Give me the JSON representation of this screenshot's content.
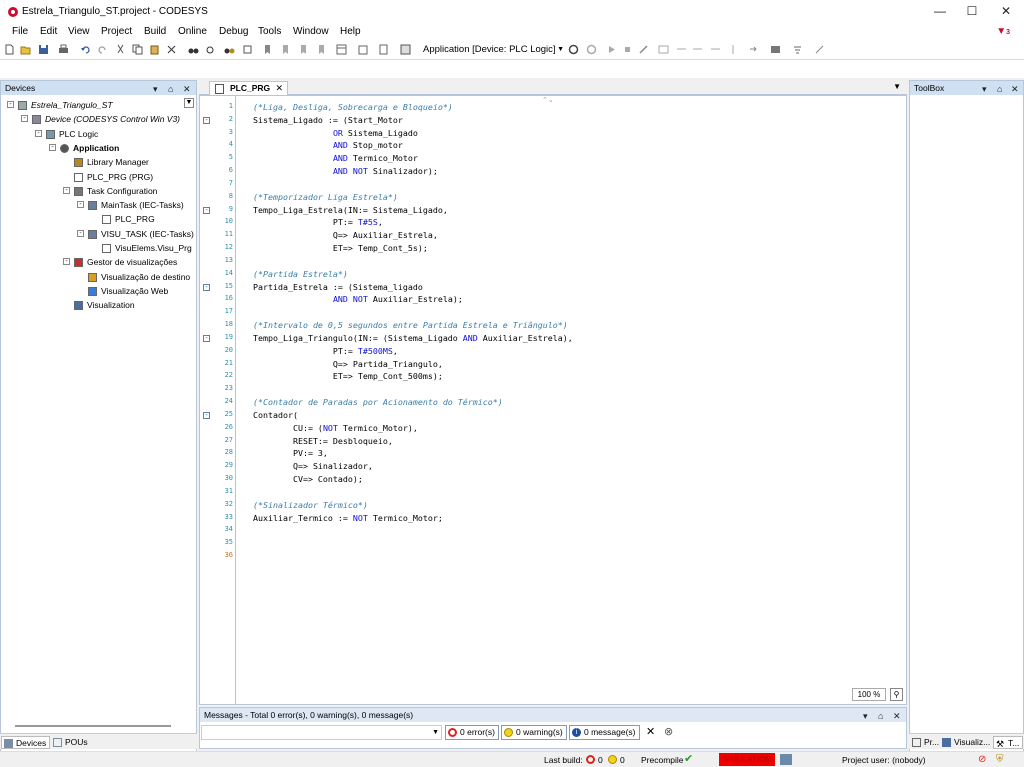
{
  "window": {
    "title": "Estrela_Triangulo_ST.project - CODESYS"
  },
  "menu": [
    "File",
    "Edit",
    "View",
    "Project",
    "Build",
    "Online",
    "Debug",
    "Tools",
    "Window",
    "Help"
  ],
  "alerts_count": "3",
  "toolbar": {
    "active_application": "Application [Device: PLC Logic]"
  },
  "devices_pane": {
    "title": "Devices",
    "tree": [
      {
        "label": "Estrela_Triangulo_ST",
        "depth": 0,
        "italic": true,
        "expander": "-",
        "icon": "project-icon"
      },
      {
        "label": "Device (CODESYS Control Win V3)",
        "depth": 1,
        "italic": true,
        "expander": "-",
        "icon": "device-icon"
      },
      {
        "label": "PLC Logic",
        "depth": 2,
        "expander": "-",
        "icon": "plc-logic-icon"
      },
      {
        "label": "Application",
        "depth": 3,
        "bold": true,
        "expander": "-",
        "icon": "application-icon"
      },
      {
        "label": "Library Manager",
        "depth": 4,
        "icon": "library-icon"
      },
      {
        "label": "PLC_PRG (PRG)",
        "depth": 4,
        "icon": "program-icon"
      },
      {
        "label": "Task Configuration",
        "depth": 4,
        "expander": "-",
        "icon": "task-config-icon"
      },
      {
        "label": "MainTask (IEC-Tasks)",
        "depth": 5,
        "expander": "-",
        "icon": "task-icon"
      },
      {
        "label": "PLC_PRG",
        "depth": 6,
        "icon": "call-icon"
      },
      {
        "label": "VISU_TASK (IEC-Tasks)",
        "depth": 5,
        "expander": "-",
        "icon": "task-icon"
      },
      {
        "label": "VisuElems.Visu_Prg",
        "depth": 6,
        "icon": "call-icon"
      },
      {
        "label": "Gestor de visualizações",
        "depth": 4,
        "expander": "-",
        "icon": "visu-manager-icon"
      },
      {
        "label": "Visualização de destino",
        "depth": 5,
        "icon": "target-visu-icon"
      },
      {
        "label": "Visualização Web",
        "depth": 5,
        "icon": "web-visu-icon"
      },
      {
        "label": "Visualization",
        "depth": 4,
        "icon": "visualization-icon"
      }
    ],
    "tabs": [
      "Devices",
      "POUs"
    ]
  },
  "editor": {
    "tab_title": "PLC_PRG",
    "zoom": "100 %",
    "lines": [
      [
        [
          "c",
          "(*Liga, Desliga, Sobrecarga e Bloqueio*)"
        ]
      ],
      [
        [
          "t",
          "Sistema_Ligado := (Start_Motor"
        ]
      ],
      [
        [
          "t",
          "                "
        ],
        [
          "k",
          "OR"
        ],
        [
          "t",
          " Sistema_Ligado"
        ]
      ],
      [
        [
          "t",
          "                "
        ],
        [
          "k",
          "AND"
        ],
        [
          "t",
          " Stop_motor"
        ]
      ],
      [
        [
          "t",
          "                "
        ],
        [
          "k",
          "AND"
        ],
        [
          "t",
          " Termico_Motor"
        ]
      ],
      [
        [
          "t",
          "                "
        ],
        [
          "k",
          "AND NOT"
        ],
        [
          "t",
          " Sinalizador);"
        ]
      ],
      [],
      [
        [
          "c",
          "(*Temporizador Liga Estrela*)"
        ]
      ],
      [
        [
          "t",
          "Tempo_Liga_Estrela(IN:= Sistema_Ligado,"
        ]
      ],
      [
        [
          "t",
          "                PT:= "
        ],
        [
          "k",
          "T#5S"
        ],
        [
          "t",
          ","
        ]
      ],
      [
        [
          "t",
          "                Q=> Auxiliar_Estrela,"
        ]
      ],
      [
        [
          "t",
          "                ET=> Temp_Cont_5s);"
        ]
      ],
      [],
      [
        [
          "c",
          "(*Partida Estrela*)"
        ]
      ],
      [
        [
          "t",
          "Partida_Estrela := (Sistema_ligado"
        ]
      ],
      [
        [
          "t",
          "                "
        ],
        [
          "k",
          "AND NOT"
        ],
        [
          "t",
          " Auxiliar_Estrela);"
        ]
      ],
      [],
      [
        [
          "c",
          "(*Intervalo de 0,5 segundos entre Partida Estrela e Triângulo*)"
        ]
      ],
      [
        [
          "t",
          "Tempo_Liga_Triangulo(IN:= (Sistema_Ligado "
        ],
        [
          "k",
          "AND"
        ],
        [
          "t",
          " Auxiliar_Estrela),"
        ]
      ],
      [
        [
          "t",
          "                PT:= "
        ],
        [
          "k",
          "T#500MS"
        ],
        [
          "t",
          ","
        ]
      ],
      [
        [
          "t",
          "                Q=> Partida_Triangulo,"
        ]
      ],
      [
        [
          "t",
          "                ET=> Temp_Cont_500ms);"
        ]
      ],
      [],
      [
        [
          "c",
          "(*Contador de Paradas por Acionamento do Térmico*)"
        ]
      ],
      [
        [
          "t",
          "Contador("
        ]
      ],
      [
        [
          "t",
          "        CU:= ("
        ],
        [
          "k",
          "NOT"
        ],
        [
          "t",
          " Termico_Motor),"
        ]
      ],
      [
        [
          "t",
          "        RESET:= Desbloqueio,"
        ]
      ],
      [
        [
          "t",
          "        PV:= 3,"
        ]
      ],
      [
        [
          "t",
          "        Q=> Sinalizador,"
        ]
      ],
      [
        [
          "t",
          "        CV=> Contado);"
        ]
      ],
      [],
      [
        [
          "c",
          "(*Sinalizador Térmico*)"
        ]
      ],
      [
        [
          "t",
          "Auxiliar_Termico := "
        ],
        [
          "k",
          "NOT"
        ],
        [
          "t",
          " Termico_Motor;"
        ]
      ],
      [],
      [],
      []
    ],
    "fold_lines": [
      2,
      9,
      15,
      19,
      25
    ]
  },
  "toolbox_pane": {
    "title": "ToolBox",
    "tabs": [
      "Pr...",
      "Visualiz...",
      "T..."
    ]
  },
  "messages_pane": {
    "title": "Messages - Total 0 error(s), 0 warning(s), 0 message(s)",
    "errors": "0 error(s)",
    "warnings": "0 warning(s)",
    "messages": "0 message(s)"
  },
  "statusbar": {
    "last_build_label": "Last build:",
    "errors": "0",
    "warnings": "0",
    "precompile": "Precompile",
    "simulation": "SIMULATION",
    "project_user": "Project user: (nobody)"
  },
  "colors": {
    "pane_header": "#cfe0f2",
    "comment": "#3c7fa8",
    "keyword": "#1010d0",
    "line_number": "#2b91af",
    "simulation": "#ee0000"
  }
}
